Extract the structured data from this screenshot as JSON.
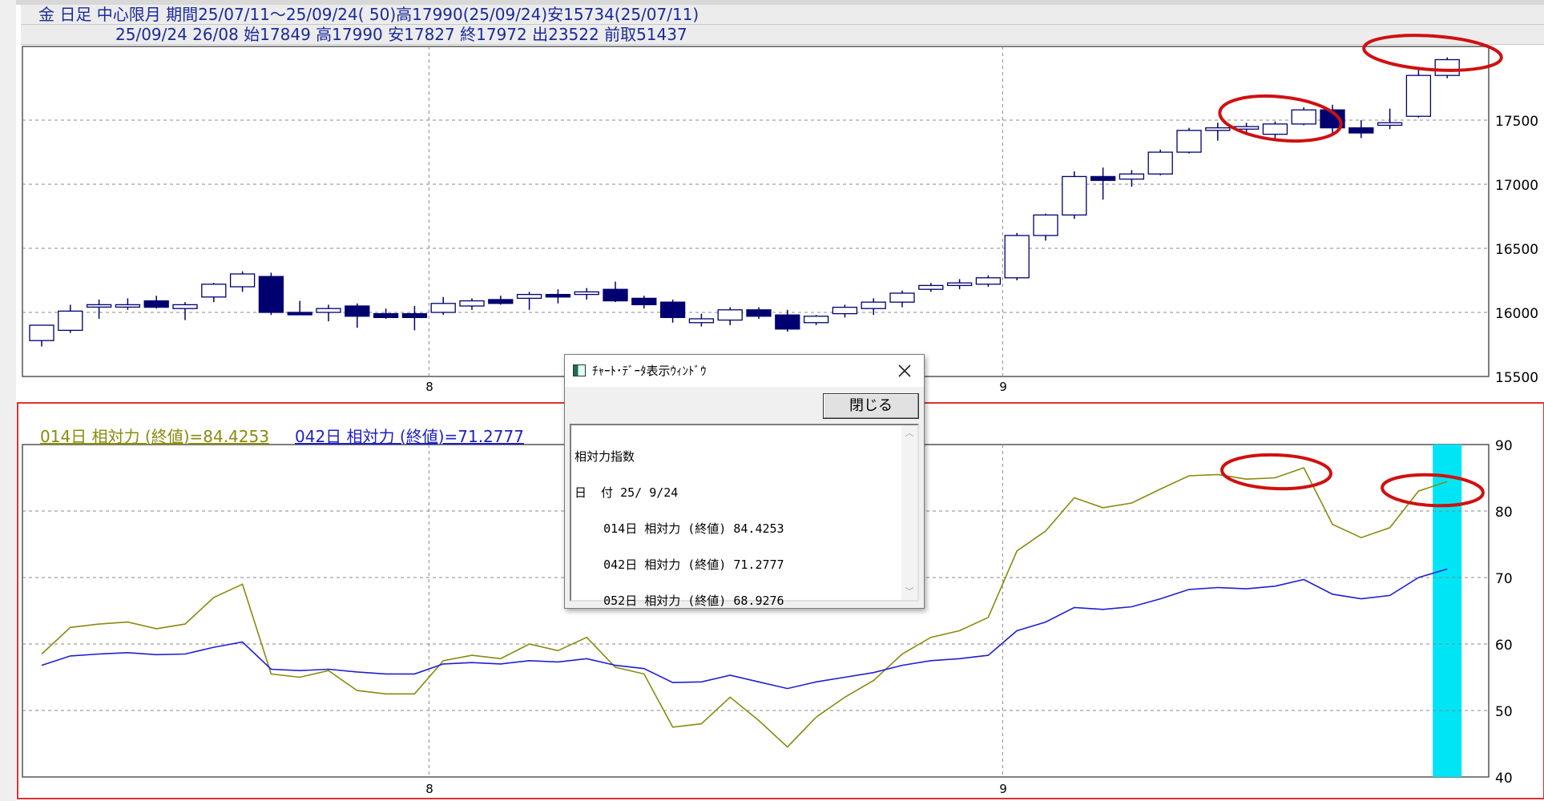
{
  "header": {
    "line1": "金 日足 中心限月 期間25/07/11～25/09/24( 50)高17990(25/09/24)安15734(25/07/11)",
    "line2": "25/09/24 26/08 始17849 高17990 安17827 終17972 出23522 前取51437"
  },
  "legend": {
    "line1": "014日 相対力 (終値)=84.4253",
    "line2": "042日 相対力 (終値)=71.2777"
  },
  "dialog": {
    "title": "ﾁｬｰﾄ･ﾃﾞｰﾀ表示ｳｨﾝﾄﾞｳ",
    "close_button": "閉じる",
    "lines": [
      "相対力指数",
      "日  付 25/ 9/24",
      "    014日 相対力 (終値) 84.4253",
      "    042日 相対力 (終値) 71.2777",
      "    052日 相対力 (終値) 68.9276"
    ]
  },
  "colors": {
    "bull_candle": "#ffffff",
    "bear_candle": "#000070",
    "candle_outline": "#000070",
    "rsi14": "#8a8a10",
    "rsi42": "#2020d0",
    "highlight_band": "#00e5f5",
    "annotation_ellipse": "#d01010",
    "lower_panel_border": "#e03030"
  },
  "chart_data": [
    {
      "type": "candlestick",
      "ylim": [
        15500,
        18000
      ],
      "yticks": [
        15500,
        16000,
        16500,
        17000,
        17500
      ],
      "xticks": [
        {
          "label": "8",
          "index": 14
        },
        {
          "label": "9",
          "index": 34
        }
      ],
      "ohlc": [
        [
          15780,
          15900,
          15734,
          15900
        ],
        [
          15860,
          16060,
          15840,
          16010
        ],
        [
          16060,
          16100,
          15950,
          16060
        ],
        [
          16060,
          16110,
          16020,
          16060
        ],
        [
          16090,
          16130,
          16030,
          16040
        ],
        [
          16030,
          16080,
          15940,
          16060
        ],
        [
          16120,
          16230,
          16080,
          16220
        ],
        [
          16200,
          16320,
          16160,
          16300
        ],
        [
          16280,
          16310,
          15980,
          16000
        ],
        [
          16000,
          16090,
          15980,
          15990
        ],
        [
          16000,
          16060,
          15930,
          16030
        ],
        [
          16050,
          16070,
          15880,
          15970
        ],
        [
          15990,
          16030,
          15950,
          15960
        ],
        [
          15990,
          16050,
          15860,
          15960
        ],
        [
          16000,
          16120,
          15980,
          16070
        ],
        [
          16050,
          16110,
          16020,
          16090
        ],
        [
          16100,
          16130,
          16060,
          16070
        ],
        [
          16110,
          16160,
          16020,
          16140
        ],
        [
          16140,
          16180,
          16070,
          16120
        ],
        [
          16140,
          16190,
          16100,
          16160
        ],
        [
          16180,
          16240,
          16080,
          16090
        ],
        [
          16110,
          16130,
          16030,
          16060
        ],
        [
          16080,
          16100,
          15920,
          15960
        ],
        [
          15920,
          15990,
          15890,
          15950
        ],
        [
          15940,
          16040,
          15900,
          16020
        ],
        [
          16020,
          16040,
          15950,
          15970
        ],
        [
          15980,
          16020,
          15850,
          15870
        ],
        [
          15920,
          15980,
          15900,
          15970
        ],
        [
          15990,
          16060,
          15960,
          16040
        ],
        [
          16030,
          16110,
          15980,
          16080
        ],
        [
          16080,
          16170,
          16040,
          16150
        ],
        [
          16180,
          16230,
          16160,
          16210
        ],
        [
          16210,
          16260,
          16180,
          16230
        ],
        [
          16220,
          16290,
          16200,
          16270
        ],
        [
          16270,
          16620,
          16250,
          16600
        ],
        [
          16600,
          16770,
          16560,
          16760
        ],
        [
          16760,
          17100,
          16730,
          17060
        ],
        [
          17060,
          17130,
          16880,
          17030
        ],
        [
          17040,
          17110,
          16980,
          17080
        ],
        [
          17080,
          17270,
          17070,
          17250
        ],
        [
          17250,
          17440,
          17240,
          17420
        ],
        [
          17420,
          17480,
          17340,
          17440
        ],
        [
          17430,
          17480,
          17390,
          17450
        ],
        [
          17390,
          17490,
          17350,
          17470
        ],
        [
          17470,
          17600,
          17460,
          17580
        ],
        [
          17580,
          17620,
          17400,
          17440
        ],
        [
          17440,
          17500,
          17360,
          17400
        ],
        [
          17460,
          17590,
          17430,
          17480
        ],
        [
          17530,
          17900,
          17520,
          17849
        ],
        [
          17849,
          17990,
          17827,
          17972
        ]
      ]
    },
    {
      "type": "line",
      "ylim": [
        40,
        90
      ],
      "yticks": [
        40,
        50,
        60,
        70,
        80,
        90
      ],
      "xticks": [
        {
          "label": "8",
          "index": 14
        },
        {
          "label": "9",
          "index": 34
        }
      ],
      "series": [
        {
          "values": [
            58.5,
            62.5,
            63.0,
            63.3,
            62.3,
            63.0,
            67.0,
            69.0,
            55.5,
            55.0,
            56.0,
            53.0,
            52.5,
            52.5,
            57.5,
            58.3,
            57.8,
            60.0,
            59.0,
            61.0,
            56.5,
            55.5,
            47.5,
            48.0,
            52.0,
            48.5,
            44.5,
            49.0,
            52.0,
            54.5,
            58.5,
            61.0,
            62.0,
            64.0,
            74.0,
            77.0,
            82.0,
            80.5,
            81.2,
            83.3,
            85.3,
            85.5,
            84.8,
            85.0,
            86.5,
            78.0,
            76.0,
            77.5,
            83.0,
            84.4253
          ]
        },
        {
          "values": [
            56.8,
            58.2,
            58.5,
            58.7,
            58.4,
            58.5,
            59.5,
            60.3,
            56.2,
            56.0,
            56.2,
            55.8,
            55.5,
            55.5,
            57.0,
            57.2,
            57.0,
            57.5,
            57.3,
            57.8,
            56.8,
            56.3,
            54.2,
            54.3,
            55.3,
            54.3,
            53.3,
            54.3,
            55.0,
            55.7,
            56.8,
            57.5,
            57.8,
            58.3,
            62.0,
            63.3,
            65.5,
            65.2,
            65.6,
            66.8,
            68.2,
            68.5,
            68.3,
            68.7,
            69.7,
            67.5,
            66.8,
            67.3,
            70.0,
            71.2777
          ]
        }
      ]
    }
  ]
}
